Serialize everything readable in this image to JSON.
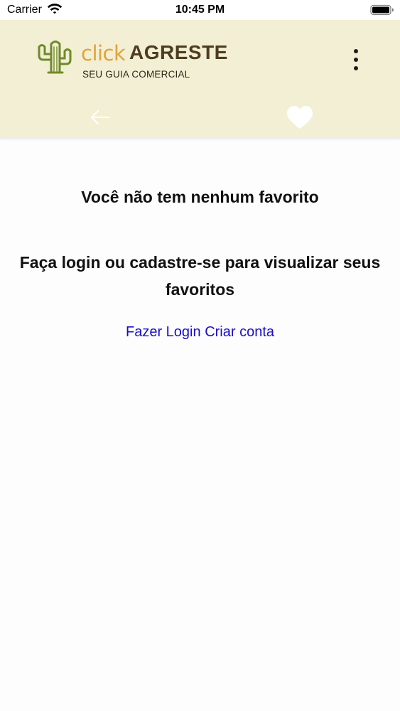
{
  "status_bar": {
    "carrier": "Carrier",
    "time": "10:45 PM",
    "wifi_icon": "wifi-icon",
    "battery_icon": "battery-icon"
  },
  "header": {
    "logo": {
      "click": "click",
      "agreste": "AGRESTE",
      "tagline": "SEU GUIA COMERCIAL"
    },
    "menu_icon": "more-vertical-icon",
    "back_icon": "arrow-left-icon",
    "favorites_icon": "heart-icon",
    "background_color": "#f3efd4"
  },
  "main": {
    "empty_title": "Você não tem nenhum favorito",
    "login_prompt": "Faça login ou cadastre-se para visualizar seus favoritos",
    "login_link": "Fazer Login",
    "signup_link": "Criar conta",
    "link_color": "#1a0dc8"
  }
}
